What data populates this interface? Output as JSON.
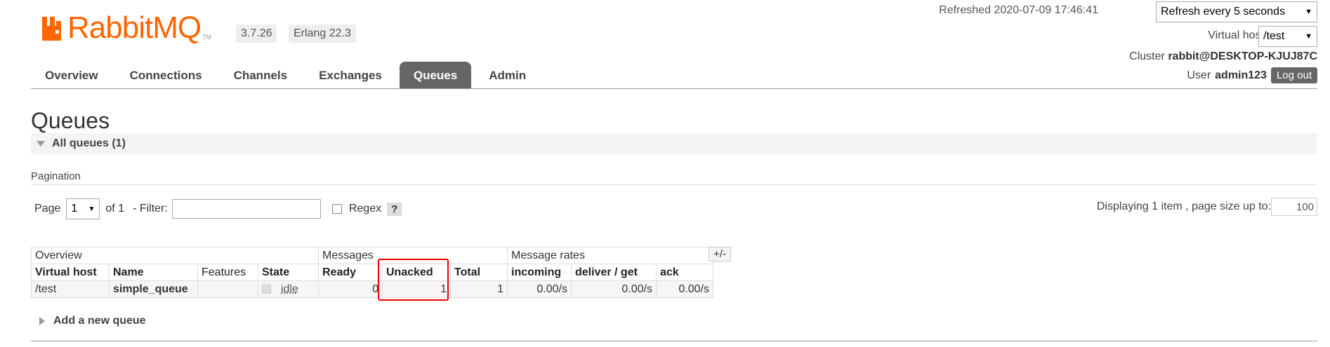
{
  "app": {
    "name": "RabbitMQ",
    "tm": "TM",
    "version": "3.7.26",
    "erlang": "Erlang 22.3"
  },
  "header": {
    "refreshed": "Refreshed 2020-07-09 17:46:41",
    "refresh_option": "Refresh every 5 seconds",
    "vhost_label": "Virtual host",
    "vhost_value": "/test",
    "cluster_label": "Cluster",
    "cluster_value": "rabbit@DESKTOP-KJUJ87C",
    "user_label": "User",
    "user_value": "admin123",
    "logout_label": "Log out"
  },
  "tabs": [
    {
      "label": "Overview"
    },
    {
      "label": "Connections"
    },
    {
      "label": "Channels"
    },
    {
      "label": "Exchanges"
    },
    {
      "label": "Queues",
      "active": true
    },
    {
      "label": "Admin"
    }
  ],
  "page": {
    "title": "Queues",
    "section": "All queues (1)"
  },
  "pagination": {
    "label": "Pagination",
    "page_label": "Page",
    "page_value": "1",
    "of_label": "of 1",
    "filter_label": "- Filter:",
    "regex_label": "Regex",
    "help": "?",
    "displaying": "Displaying 1 item , page size up to:",
    "page_size": "100"
  },
  "table": {
    "groups": [
      "Overview",
      "Messages",
      "Message rates"
    ],
    "plus_minus": "+/-",
    "columns": [
      "Virtual host",
      "Name",
      "Features",
      "State",
      "Ready",
      "Unacked",
      "Total",
      "incoming",
      "deliver / get",
      "ack"
    ],
    "rows": [
      {
        "vhost": "/test",
        "name": "simple_queue",
        "features": "",
        "state": "idle",
        "ready": "0",
        "unacked": "1",
        "total": "1",
        "incoming": "0.00/s",
        "deliver_get": "0.00/s",
        "ack": "0.00/s"
      }
    ]
  },
  "add_queue": "Add a new queue",
  "colors": {
    "brand": "#ff6600",
    "tab_active": "#666666",
    "highlight": "#ee0000"
  }
}
